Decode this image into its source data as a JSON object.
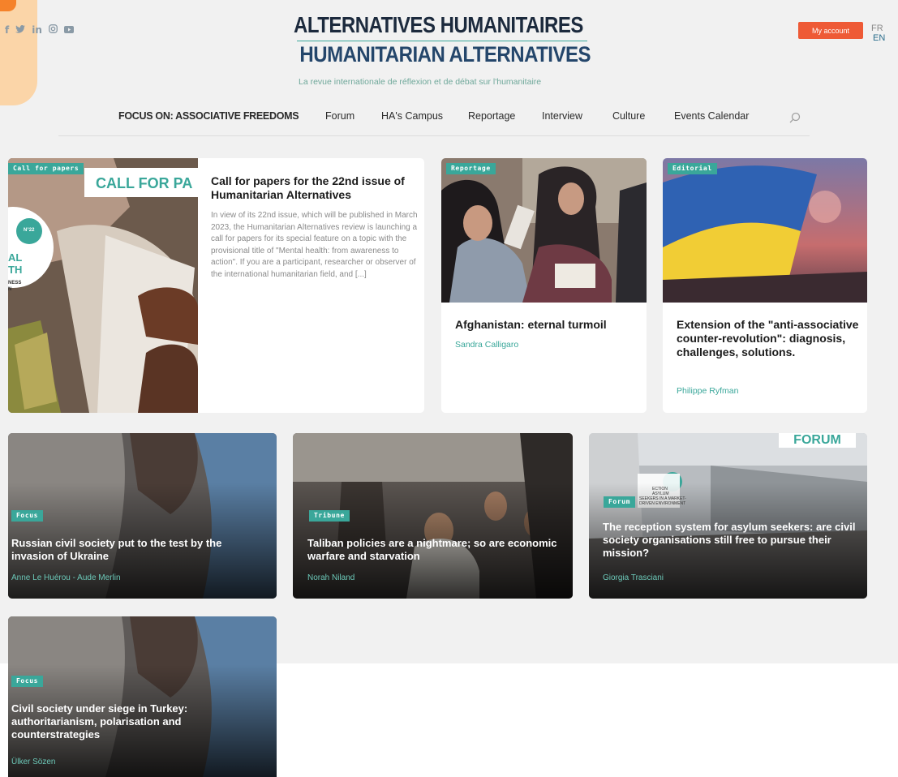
{
  "social": [
    "f",
    "t",
    "in",
    "ig",
    "yt"
  ],
  "logo": {
    "title_fr": "ALTERNATIVES HUMANITAIRES",
    "title_en": "HUMANITARIAN ALTERNATIVES",
    "tagline": "La revue internationale de réflexion et de débat sur l'humanitaire"
  },
  "header": {
    "account_label": "My account",
    "lang_fr": "FR",
    "lang_en": "EN"
  },
  "nav": {
    "items": [
      "FOCUS ON: ASSOCIATIVE FREEDOMS",
      "Forum",
      "HA's Campus",
      "Reportage",
      "Interview",
      "Culture",
      "Events Calendar"
    ]
  },
  "featured": {
    "tag": "Call for papers",
    "banner": "CALL FOR PA",
    "badge": "N°22",
    "cover_lines": [
      "AL",
      "TH",
      "NESS",
      "N"
    ],
    "title": "Call for papers for the 22nd issue of Humanitarian Alternatives",
    "excerpt": "In view of its 22nd issue, which will be published in March 2023, the Humanitarian Alternatives review is launching a call for papers for its special feature on a topic with the provisional title of \"Mental health: from awareness to action\". If you are a participant, researcher or observer of the international humanitarian field, and [...]"
  },
  "cards": [
    {
      "tag": "Reportage",
      "title": "Afghanistan: eternal turmoil",
      "author": "Sandra Calligaro"
    },
    {
      "tag": "Editorial",
      "title": "Extension of the \"anti-associative counter-revolution\": diagnosis, challenges, solutions.",
      "author": "Philippe Ryfman"
    }
  ],
  "dark_cards": [
    {
      "tag": "Focus",
      "title": "Russian civil society put to the test by the invasion of Ukraine",
      "author": "Anne Le Huérou - Aude Merlin"
    },
    {
      "tag": "Tribune",
      "title": "Taliban policies are a nightmare; so are economic warfare and starvation",
      "author": "Norah Niland"
    },
    {
      "tag": "Forum",
      "title": "The reception system for asylum seekers: are civil society organisations still free to pursue their mission?",
      "author": "Giorgia Trasciani",
      "banner": "FORUM",
      "poster_lines": [
        "ECTION",
        "ASYLUM",
        "SEEKERS IN A MARKET-",
        "DRIVEN ENVIRONMENT"
      ]
    },
    {
      "tag": "Focus",
      "title": "Civil society under siege in Turkey: authoritarianism, polarisation and counterstrategies",
      "author": "Ülker Sözen"
    }
  ]
}
